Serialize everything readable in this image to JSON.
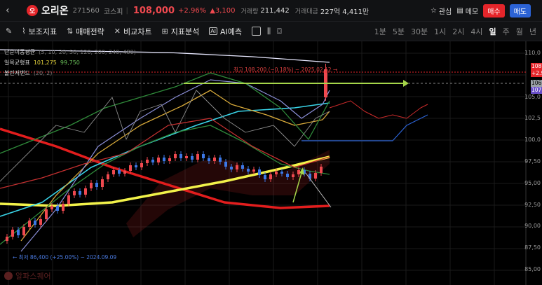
{
  "header": {
    "back_icon": "chevron-left-icon",
    "logo_text": "오",
    "name": "오리온",
    "code": "271560",
    "market": "코스피",
    "price": "108,000",
    "pct": "+2.96%",
    "change": "▲3,100",
    "volume_label": "거래량",
    "volume": "211,442",
    "amount_label": "거래대금",
    "amount": "227억 4,411만",
    "watch_label": "관심",
    "memo_label": "메모",
    "buy_label": "매수",
    "sell_label": "매도"
  },
  "toolbar": {
    "indicators_label": "보조지표",
    "strategy_label": "매매전략",
    "compare_label": "비교차트",
    "analysis_label": "지표분석",
    "ai_label": "AI예측",
    "periods": [
      "1분",
      "5분",
      "30분",
      "1시",
      "2시",
      "4시",
      "일",
      "주",
      "월",
      "년"
    ],
    "active_period": "일"
  },
  "legend": {
    "ma_label": "단순이동평균",
    "ma_params": "(5, 10, 20, 50, 120, 200, 240, 480)",
    "ichimoku_label": "일목균형표",
    "ichimoku_v1": "101,275",
    "ichimoku_v2": "99,750",
    "bb_label": "볼린저밴드",
    "bb_params": "(20, 2)"
  },
  "annotations": {
    "high": "최고 108,200 (−0.18%) − 2025.02.12 →",
    "low": "← 최저 86,400 (+25.00%) − 2024.09.09"
  },
  "watermark": "알파스퀘어",
  "y_axis": [
    "110,0",
    "105,0",
    "102,5",
    "100,0",
    "97,50",
    "95,00",
    "92,50",
    "90,00",
    "87,50",
    "85,00"
  ],
  "price_tags": {
    "t1": "108,",
    "t2": "+2.9",
    "t3": "106,",
    "t4": "107,"
  },
  "colors": {
    "up": "#f0494f",
    "down": "#2c63d6",
    "ma_red": "#e21d1d",
    "ma_yellow": "#f2f24a",
    "ma_cyan": "#39d4e8",
    "arrow_green": "#a6d64a"
  }
}
